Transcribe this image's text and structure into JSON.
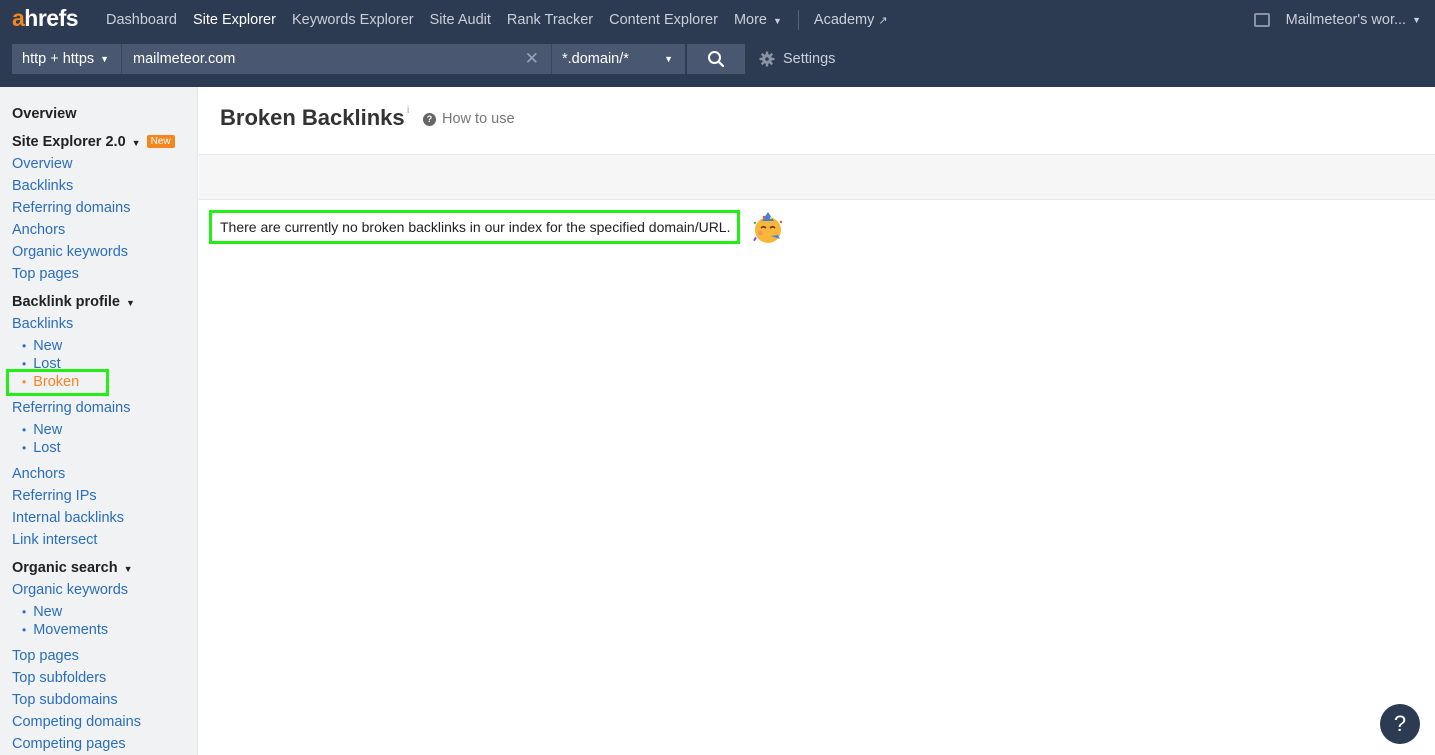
{
  "nav": {
    "logo_a": "a",
    "logo_rest": "hrefs",
    "items": [
      {
        "label": "Dashboard"
      },
      {
        "label": "Site Explorer"
      },
      {
        "label": "Keywords Explorer"
      },
      {
        "label": "Site Audit"
      },
      {
        "label": "Rank Tracker"
      },
      {
        "label": "Content Explorer"
      },
      {
        "label": "More"
      }
    ],
    "academy": "Academy",
    "account": "Mailmeteor's wor..."
  },
  "search": {
    "protocol": "http + https",
    "url": "mailmeteor.com",
    "mode": "*.domain/*",
    "settings": "Settings"
  },
  "sidebar": {
    "overview_head": "Overview",
    "se2_head": "Site Explorer 2.0",
    "new_badge": "New",
    "se2_links": [
      "Overview",
      "Backlinks",
      "Referring domains",
      "Anchors",
      "Organic keywords",
      "Top pages"
    ],
    "backlink_head": "Backlink profile",
    "backlinks": "Backlinks",
    "backlinks_new": "New",
    "backlinks_lost": "Lost",
    "backlinks_broken": "Broken",
    "ref_domains": "Referring domains",
    "ref_new": "New",
    "ref_lost": "Lost",
    "more_links": [
      "Anchors",
      "Referring IPs",
      "Internal backlinks",
      "Link intersect"
    ],
    "organic_head": "Organic search",
    "organic_keywords": "Organic keywords",
    "ok_new": "New",
    "ok_movements": "Movements",
    "organic_links": [
      "Top pages",
      "Top subfolders",
      "Top subdomains",
      "Competing domains",
      "Competing pages"
    ]
  },
  "main": {
    "title": "Broken Backlinks",
    "info": "i",
    "howto": "How to use",
    "message": "There are currently no broken backlinks in our index for the specified domain/URL."
  },
  "help": "?",
  "colors": {
    "topbar": "#2c3a52",
    "accent": "#f5851f",
    "link": "#2a6ebb",
    "highlight": "#22f014"
  }
}
